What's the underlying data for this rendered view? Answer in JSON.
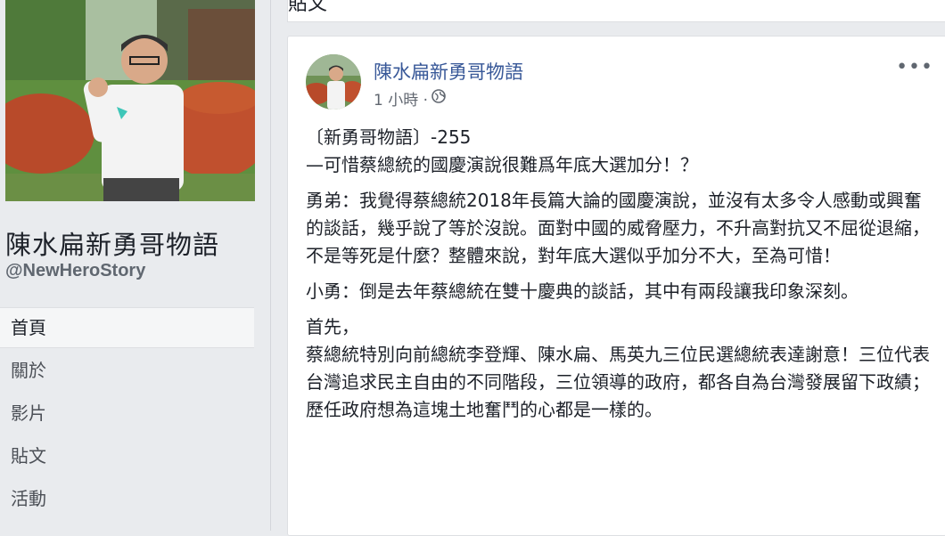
{
  "sidebar": {
    "page_name": "陳水扁新勇哥物語",
    "page_handle": "@NewHeroStory",
    "nav": [
      {
        "label": "首頁"
      },
      {
        "label": "關於"
      },
      {
        "label": "影片"
      },
      {
        "label": "貼文"
      },
      {
        "label": "活動"
      }
    ]
  },
  "posts_header": "貼文",
  "post": {
    "author": "陳水扁新勇哥物語",
    "time": "1 小時 ·",
    "title_line1": "〔新勇哥物語〕-255",
    "title_line2": "—可惜蔡總統的國慶演說很難爲年底大選加分！？",
    "para1": "勇弟：我覺得蔡總統2018年長篇大論的國慶演說，並沒有太多令人感動或興奮的談話，幾乎說了等於沒說。面對中國的威脅壓力，不升高對抗又不屈從退縮，不是等死是什麼？整體來說，對年底大選似乎加分不大，至為可惜！",
    "para2": "小勇：倒是去年蔡總統在雙十慶典的談話，其中有兩段讓我印象深刻。",
    "para3_line1": "首先，",
    "para3_line2": "蔡總統特別向前總統李登輝、陳水扁、馬英九三位民選總統表達謝意！三位代表台灣追求民主自由的不同階段，三位領導的政府，都各自為台灣發展留下政績；歷任政府想為這塊土地奮鬥的心都是一樣的。"
  },
  "icons": {
    "globe": "globe-icon",
    "more": "more-options-icon"
  }
}
